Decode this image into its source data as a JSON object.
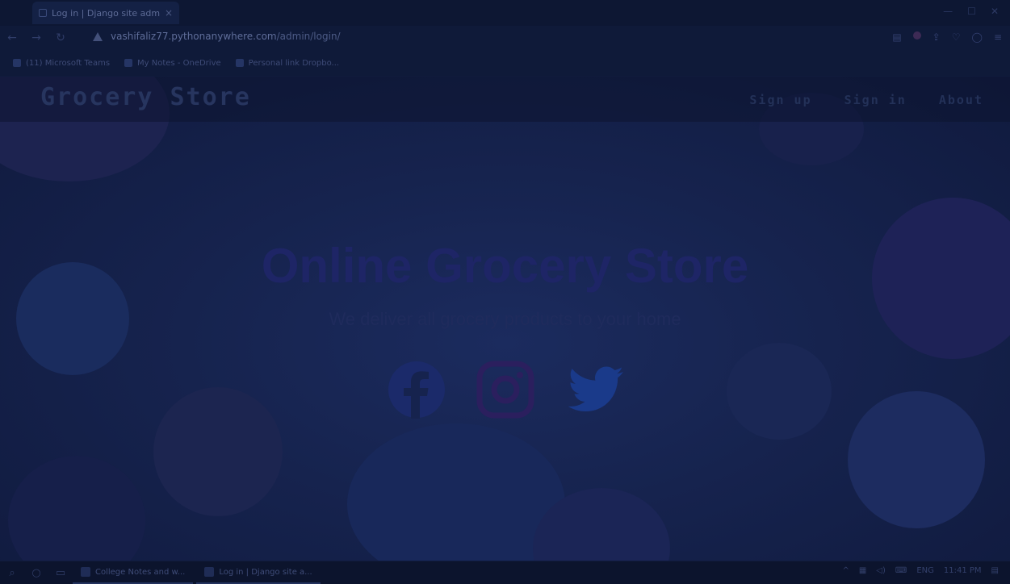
{
  "browser": {
    "tab_title": "Log in | Django site admin",
    "tab_close": "×",
    "url_host": "vashifaliz77.pythonanywhere.com",
    "url_path": "/admin/login/",
    "window_controls": [
      "—",
      "☐",
      "✕"
    ],
    "nav_icons": [
      "back-icon",
      "forward-icon",
      "reload-icon"
    ],
    "bookmarks": [
      {
        "label": "(11) Microsoft Teams",
        "icon": "teams-icon"
      },
      {
        "label": "My Notes - OneDrive",
        "icon": "onedrive-icon"
      },
      {
        "label": "Personal link Dropbo...",
        "icon": "bookmark-icon"
      }
    ]
  },
  "site": {
    "brand": "Grocery Store",
    "nav": [
      "Sign up",
      "Sign in",
      "About"
    ],
    "hero_title": "Online Grocery Store",
    "hero_subtitle": "We deliver all grocery products to your home",
    "social": [
      "facebook-icon",
      "instagram-icon",
      "twitter-icon"
    ]
  },
  "taskbar": {
    "apps": [
      {
        "label": "College Notes and w..."
      },
      {
        "label": "Log in | Django site a..."
      }
    ],
    "language": "ENG",
    "time": "11:41 PM"
  },
  "colors": {
    "overlay": "#101b3c",
    "title": "#1e2566"
  }
}
